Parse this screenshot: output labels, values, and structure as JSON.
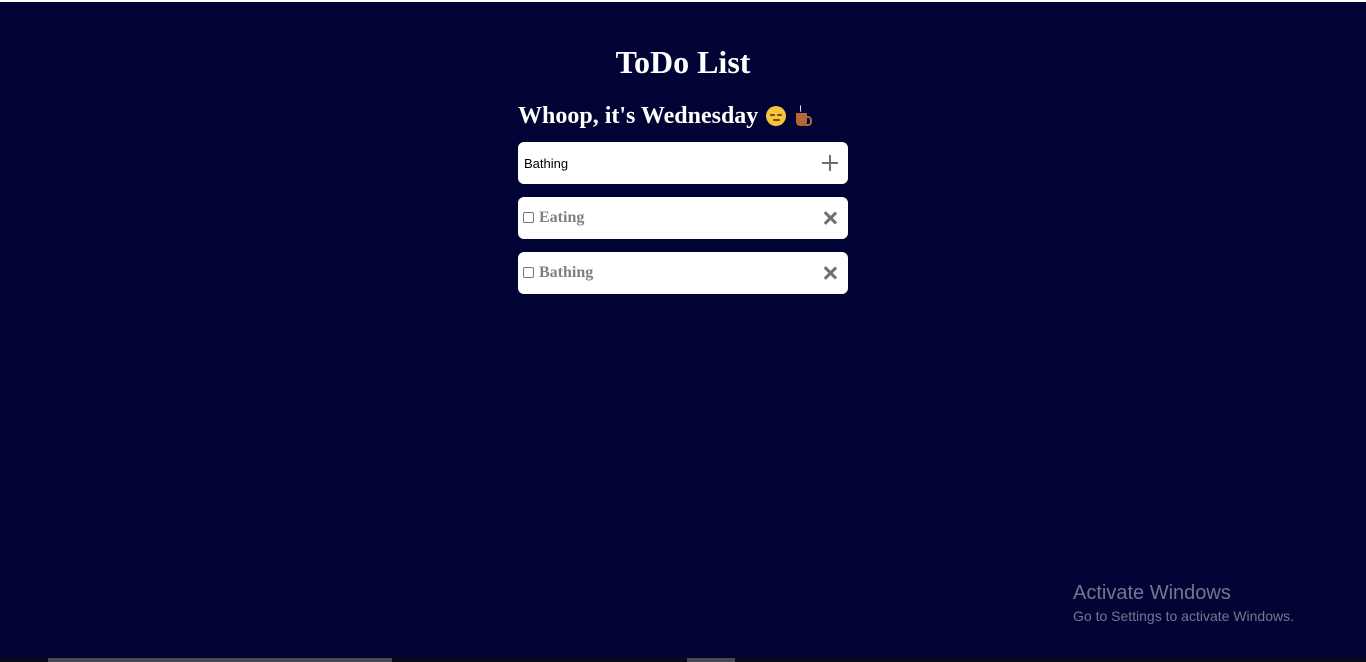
{
  "title": "ToDo List",
  "subtitle": "Whoop, it's Wednesday",
  "subtitle_emoji": [
    "relieved-face-icon",
    "hot-beverage-icon"
  ],
  "input": {
    "value": "Bathing",
    "add_icon": "plus-icon"
  },
  "todos": [
    {
      "label": "Eating",
      "checked": false,
      "delete_icon": "close-icon"
    },
    {
      "label": "Bathing",
      "checked": false,
      "delete_icon": "close-icon"
    }
  ],
  "watermark": {
    "title": "Activate Windows",
    "subtitle": "Go to Settings to activate Windows."
  },
  "colors": {
    "background": "#000333",
    "card": "#ffffff",
    "item_text": "#808080",
    "icon": "#707070"
  }
}
